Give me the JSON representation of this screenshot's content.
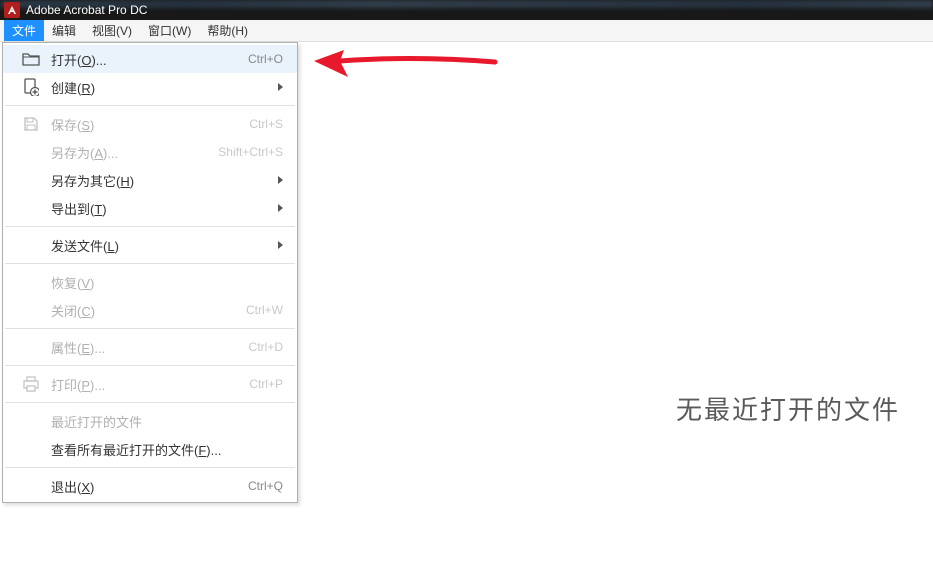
{
  "titlebar": {
    "app_name": "Adobe Acrobat Pro DC"
  },
  "menubar": {
    "items": [
      {
        "label": "文件"
      },
      {
        "label": "编辑"
      },
      {
        "label": "视图(V)"
      },
      {
        "label": "窗口(W)"
      },
      {
        "label": "帮助(H)"
      }
    ]
  },
  "dropdown": {
    "items": [
      {
        "label": "打开(O)...",
        "underline": "O",
        "shortcut": "Ctrl+O",
        "icon": "folder",
        "highlighted": true
      },
      {
        "label": "创建(R)",
        "underline": "R",
        "icon": "create",
        "submenu": true
      },
      {
        "sep": true
      },
      {
        "label": "保存(S)",
        "underline": "S",
        "shortcut": "Ctrl+S",
        "icon": "save",
        "disabled": true
      },
      {
        "label": "另存为(A)...",
        "underline": "A",
        "shortcut": "Shift+Ctrl+S",
        "disabled": true
      },
      {
        "label": "另存为其它(H)",
        "underline": "H",
        "submenu": true
      },
      {
        "label": "导出到(T)",
        "underline": "T",
        "submenu": true
      },
      {
        "sep": true
      },
      {
        "label": "发送文件(L)",
        "underline": "L",
        "submenu": true
      },
      {
        "sep": true
      },
      {
        "label": "恢复(V)",
        "underline": "V",
        "disabled": true
      },
      {
        "label": "关闭(C)",
        "underline": "C",
        "shortcut": "Ctrl+W",
        "disabled": true
      },
      {
        "sep": true
      },
      {
        "label": "属性(E)...",
        "underline": "E",
        "shortcut": "Ctrl+D",
        "disabled": true
      },
      {
        "sep": true
      },
      {
        "label": "打印(P)...",
        "underline": "P",
        "shortcut": "Ctrl+P",
        "icon": "print",
        "disabled": true
      },
      {
        "sep": true
      },
      {
        "label": "最近打开的文件",
        "disabled": true
      },
      {
        "label": "查看所有最近打开的文件(F)...",
        "underline": "F"
      },
      {
        "sep": true
      },
      {
        "label": "退出(X)",
        "underline": "X",
        "shortcut": "Ctrl+Q"
      }
    ]
  },
  "main": {
    "message": "无最近打开的文件"
  },
  "colors": {
    "highlight": "#eaf3fb",
    "menu_active": "#1e90ff",
    "annotation": "#e8192c"
  }
}
